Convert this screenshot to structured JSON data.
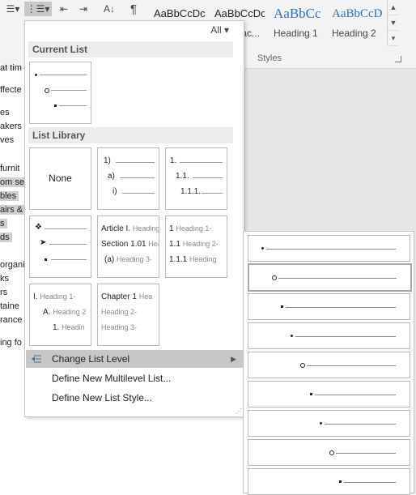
{
  "ribbon": {
    "styles_group_label": "Styles",
    "styles": [
      {
        "sample": "AaBbCcDc",
        "name": ""
      },
      {
        "sample": "AaBbCcDc",
        "name": "No Spac..."
      },
      {
        "sample": "AaBbCc",
        "name": "Heading 1"
      },
      {
        "sample": "AaBbCcD",
        "name": "Heading 2"
      }
    ],
    "pilcrow": "¶"
  },
  "document": {
    "lines": [
      {
        "text": "at tim",
        "selected": false
      },
      {
        "text": "ffecte",
        "selected": false
      },
      {
        "text": "es",
        "selected": false
      },
      {
        "text": "akers",
        "selected": false
      },
      {
        "text": "ves",
        "selected": false
      },
      {
        "text": "furnit",
        "selected": false
      },
      {
        "text": "om se",
        "selected": true
      },
      {
        "text": "bles",
        "selected": true
      },
      {
        "text": "airs &",
        "selected": true
      },
      {
        "text": "s",
        "selected": true
      },
      {
        "text": "ds",
        "selected": true
      },
      {
        "text": "organi",
        "selected": false
      },
      {
        "text": "ks",
        "selected": false
      },
      {
        "text": "rs",
        "selected": false
      },
      {
        "text": "taine",
        "selected": false
      },
      {
        "text": "rance",
        "selected": false
      },
      {
        "text": "ing fo",
        "selected": false
      }
    ]
  },
  "dropdown": {
    "filter_label": "All",
    "current_list_header": "Current List",
    "list_library_header": "List Library",
    "none_label": "None",
    "tile_numbered": [
      "1)",
      "a)",
      "i)"
    ],
    "tile_decimal": [
      "1.",
      "1.1.",
      "1.1.1."
    ],
    "tile_article": [
      "Article I.",
      "Heading",
      "Section 1.01",
      "Head",
      "(a)",
      "Heading 3-"
    ],
    "tile_legal": [
      "1",
      "Heading 1-",
      "1.1",
      "Heading 2-",
      "1.1.1",
      "Heading"
    ],
    "tile_roman": [
      "I.",
      "Heading 1-",
      "A.",
      "Heading 2",
      "1.",
      "Headin"
    ],
    "tile_chapter": [
      "Chapter 1",
      "Hea",
      "Heading 2-",
      "Heading 3-"
    ],
    "menu": {
      "change_level": "Change List Level",
      "define_multilevel": "Define New Multilevel List...",
      "define_style": "Define New List Style..."
    }
  },
  "colors": {
    "highlight": "#c7c7c7",
    "heading_blue": "#2e74b5",
    "section_header_bg": "#ececec"
  }
}
